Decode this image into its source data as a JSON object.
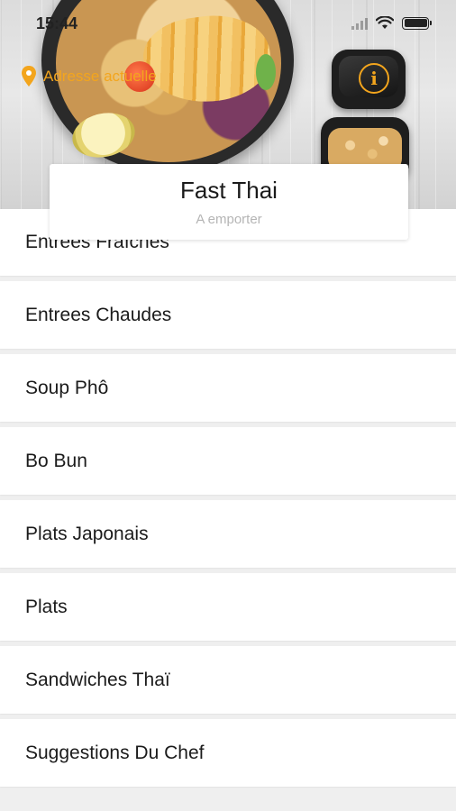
{
  "status_bar": {
    "time": "15:44",
    "icons": [
      "signal-icon",
      "wifi-icon",
      "battery-icon"
    ]
  },
  "header": {
    "address_label": "Adresse actuelle",
    "address_icon": "location-pin-icon",
    "info_icon": "info-icon",
    "accent_color": "#f3a51d"
  },
  "restaurant": {
    "name": "Fast Thai",
    "subtitle": "A emporter"
  },
  "menu": {
    "categories": [
      {
        "label": "Entrees Fraîches"
      },
      {
        "label": "Entrees Chaudes"
      },
      {
        "label": "Soup Phô"
      },
      {
        "label": "Bo Bun"
      },
      {
        "label": "Plats Japonais"
      },
      {
        "label": "Plats"
      },
      {
        "label": "Sandwiches Thaï"
      },
      {
        "label": "Suggestions Du Chef"
      }
    ]
  }
}
